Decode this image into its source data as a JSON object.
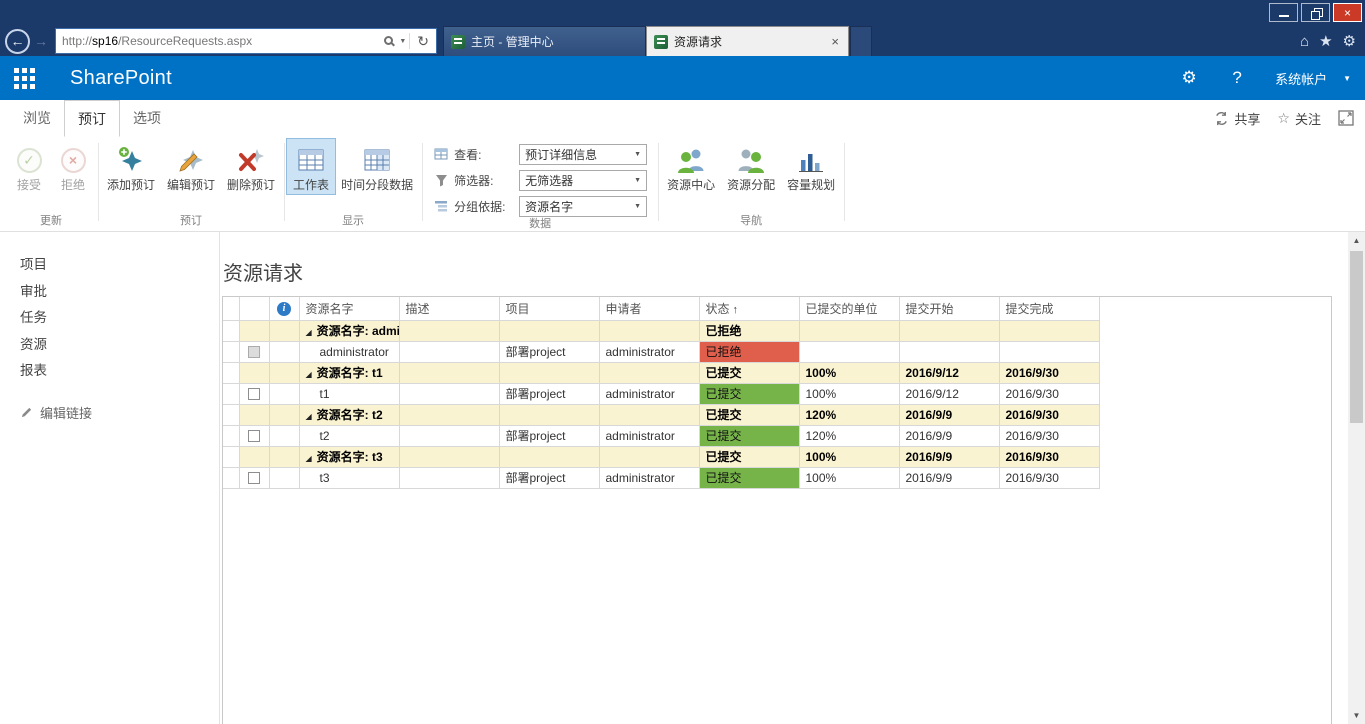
{
  "browser": {
    "address": {
      "protocol": "http://",
      "host": "sp16",
      "path": "/ResourceRequests.aspx"
    },
    "tabs": [
      {
        "title": "主页 - 管理中心"
      },
      {
        "title": "资源请求"
      }
    ]
  },
  "suite_bar": {
    "brand": "SharePoint",
    "account": "系统帐户"
  },
  "ribbon": {
    "tabs": [
      {
        "label": "浏览"
      },
      {
        "label": "预订"
      },
      {
        "label": "选项"
      }
    ],
    "share_label": "共享",
    "follow_label": "关注",
    "groups": {
      "update": {
        "label": "更新",
        "accept": "接受",
        "reject": "拒绝"
      },
      "booking": {
        "label": "预订",
        "add": "添加预订",
        "edit": "编辑预订",
        "delete": "删除预订"
      },
      "display": {
        "label": "显示",
        "sheet": "工作表",
        "timephased": "时间分段数据"
      },
      "data": {
        "label": "数据",
        "view_label": "查看:",
        "view_value": "预订详细信息",
        "filter_label": "筛选器:",
        "filter_value": "无筛选器",
        "group_label": "分组依据:",
        "group_value": "资源名字"
      },
      "nav": {
        "label": "导航",
        "resource_center": "资源中心",
        "resource_assignments": "资源分配",
        "capacity_planning": "容量规划"
      }
    }
  },
  "sidebar": {
    "items": [
      "项目",
      "审批",
      "任务",
      "资源",
      "报表"
    ],
    "edit_links": "编辑链接"
  },
  "main": {
    "title": "资源请求",
    "table": {
      "columns": [
        "资源名字",
        "描述",
        "项目",
        "申请者",
        "状态",
        "已提交的单位",
        "提交开始",
        "提交完成"
      ],
      "sort": {
        "column": "状态",
        "direction": "asc",
        "indicator": "↑"
      },
      "rows": [
        {
          "type": "group",
          "name": "资源名字: administrator",
          "status": "已拒绝",
          "units": "",
          "start": "",
          "finish": ""
        },
        {
          "type": "item",
          "checkbox": "disabled",
          "name": "administrator",
          "description": "",
          "project": "部署project",
          "requester": "administrator",
          "status": "已拒绝",
          "status_style": "rejected",
          "units": "",
          "start": "",
          "finish": ""
        },
        {
          "type": "group",
          "name": "资源名字: t1",
          "status": "已提交",
          "units": "100%",
          "start": "2016/9/12",
          "finish": "2016/9/30"
        },
        {
          "type": "item",
          "checkbox": "normal",
          "name": "t1",
          "description": "",
          "project": "部署project",
          "requester": "administrator",
          "status": "已提交",
          "status_style": "committed",
          "units": "100%",
          "start": "2016/9/12",
          "finish": "2016/9/30"
        },
        {
          "type": "group",
          "name": "资源名字: t2",
          "status": "已提交",
          "units": "120%",
          "start": "2016/9/9",
          "finish": "2016/9/30"
        },
        {
          "type": "item",
          "checkbox": "normal",
          "name": "t2",
          "description": "",
          "project": "部署project",
          "requester": "administrator",
          "status": "已提交",
          "status_style": "committed",
          "units": "120%",
          "start": "2016/9/9",
          "finish": "2016/9/30"
        },
        {
          "type": "group",
          "name": "资源名字: t3",
          "status": "已提交",
          "units": "100%",
          "start": "2016/9/9",
          "finish": "2016/9/30"
        },
        {
          "type": "item",
          "checkbox": "normal",
          "name": "t3",
          "description": "",
          "project": "部署project",
          "requester": "administrator",
          "status": "已提交",
          "status_style": "committed",
          "units": "100%",
          "start": "2016/9/9",
          "finish": "2016/9/30"
        }
      ]
    }
  },
  "colors": {
    "suite_bar": "#0072C6",
    "status_rejected": "#DF5F4C",
    "status_committed": "#76B349",
    "group_row": "#FAF3D1"
  },
  "icons": {
    "back": "←",
    "forward": "→",
    "refresh": "↻",
    "home": "⌂",
    "favorites": "★",
    "tools": "⚙",
    "gear": "⚙",
    "help": "?",
    "caret_down": "▼",
    "dropdown": "▾",
    "close": "×",
    "check": "✓",
    "cross": "×",
    "group_expanded": "◢",
    "info": "i",
    "follow_star": "☆",
    "scroll_up": "▲",
    "scroll_down": "▼"
  }
}
